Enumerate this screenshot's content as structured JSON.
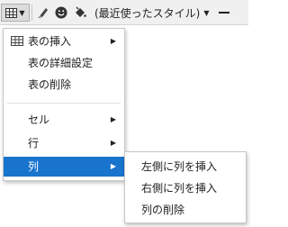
{
  "toolbar": {
    "table_button": {
      "icon": "table-icon"
    },
    "tools": [
      {
        "name": "eraser-icon"
      },
      {
        "name": "smiley-icon"
      },
      {
        "name": "paint-bucket-icon"
      }
    ],
    "style_select": {
      "value": "(最近使ったスタイル)"
    },
    "horizontal_rule": {
      "icon": "horizontal-line-icon"
    }
  },
  "menu": {
    "items": [
      {
        "label": "表の挿入",
        "has_submenu": true,
        "icon": "table-icon"
      },
      {
        "label": "表の詳細設定"
      },
      {
        "label": "表の削除"
      },
      {
        "label": "セル",
        "has_submenu": true
      },
      {
        "label": "行",
        "has_submenu": true
      },
      {
        "label": "列",
        "has_submenu": true,
        "active": true
      }
    ]
  },
  "submenu": {
    "items": [
      {
        "label": "左側に列を挿入"
      },
      {
        "label": "右側に列を挿入"
      },
      {
        "label": "列の削除"
      }
    ]
  },
  "colors": {
    "active_bg": "#1874cd",
    "toolbar_bg": "#f0f0f0"
  }
}
